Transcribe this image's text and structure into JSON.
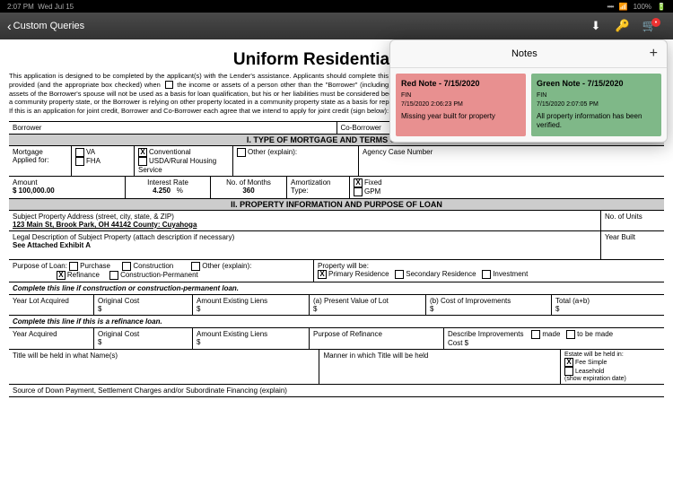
{
  "status": {
    "time": "2:07 PM",
    "date": "Wed Jul 15",
    "signal": "••••",
    "wifi": "◢",
    "battery": "100%"
  },
  "nav": {
    "back": "Custom Queries"
  },
  "notes": {
    "title": "Notes",
    "items": [
      {
        "title": "Red Note - 7/15/2020",
        "sub": "FIN",
        "ts": "7/15/2020 2:06:23 PM",
        "body": "Missing year built for property"
      },
      {
        "title": "Green Note - 7/15/2020",
        "sub": "FIN",
        "ts": "7/15/2020 2:07:05 PM",
        "body": "All property information has been verified."
      }
    ]
  },
  "doc": {
    "title": "Uniform Residential Loan",
    "intro": "This application is designed to be completed by the applicant(s) with the Lender's assistance. Applicants should complete this form as \"Borrower\" or \"Co-Borrower\", as applicable. Co-Borrower information must also be provided (and the appropriate box checked) when ☐ the income or assets of a person other than the \"Borrower\" (including the Borrower's spouse) will be used as a basis for loan qualification or ☐ the income or assets of the Borrower's spouse will not be used as a basis for loan qualification, but his or her liabilities must be considered because the Borrower resides in a community property state, the security property is located in a community property state, or the Borrower is relying on other property located in a community property state as a basis for repayment of the loan.",
    "intro2": "If this is an application for joint credit, Borrower and Co-Borrower each agree that we intend to apply for joint credit (sign below):",
    "borrower": "Borrower",
    "coborrower": "Co-Borrower",
    "sec1": "I. TYPE OF MORTGAGE AND TERMS OF LOAN",
    "mortgage": {
      "lbl": "Mortgage",
      "applied": "Applied for:",
      "va": "VA",
      "fha": "FHA",
      "conv": "Conventional",
      "usda": "USDA/Rural Housing Service",
      "other": "Other (explain):",
      "agency": "Agency Case Number"
    },
    "amount": {
      "lbl": "Amount",
      "val": "$ 100,000.00",
      "rate_lbl": "Interest Rate",
      "rate": "4.250",
      "pct": "%",
      "months_lbl": "No. of Months",
      "months": "360",
      "amort_lbl": "Amortization Type:",
      "fixed": "Fixed",
      "gpm": "GPM"
    },
    "sec2": "II. PROPERTY INFORMATION AND PURPOSE OF LOAN",
    "addr_lbl": "Subject Property Address (street, city, state, & ZIP)",
    "addr": "123 Main St, Brook Park, OH 44142 County: Cuyahoga",
    "units": "No. of Units",
    "legal_lbl": "Legal Description of Subject Property (attach description if necessary)",
    "legal": "See Attached Exhibit A",
    "year_built": "Year Built",
    "purpose": {
      "lbl": "Purpose of Loan:",
      "purchase": "Purchase",
      "refi": "Refinance",
      "constr": "Construction",
      "constrperm": "Construction-Permanent",
      "other": "Other (explain):"
    },
    "propwill": {
      "lbl": "Property will be:",
      "primary": "Primary Residence",
      "secondary": "Secondary Residence",
      "invest": "Investment"
    },
    "line1": "Complete this line if construction or construction-permanent loan.",
    "constr_cols": {
      "a": "Year Lot Acquired",
      "b": "Original Cost",
      "c": "Amount Existing Liens",
      "d": "(a) Present Value of Lot",
      "e": "(b) Cost of Improvements",
      "f": "Total (a+b)"
    },
    "dollar": "$",
    "line2": "Complete this line if this is a refinance loan.",
    "refi_cols": {
      "a": "Year Acquired",
      "b": "Original Cost",
      "c": "Amount Existing Liens",
      "d": "Purpose of Refinance",
      "e": "Describe Improvements",
      "e2": "Cost $",
      "made": "made",
      "tobe": "to be made"
    },
    "title_lbl": "Title will be held in what Name(s)",
    "manner": "Manner in which Title will be held",
    "estate": {
      "lbl": "Estate will be held in:",
      "fee": "Fee Simple",
      "lease": "Leasehold",
      "exp": "(show expiration date)"
    },
    "source": "Source of Down Payment, Settlement Charges and/or Subordinate Financing (explain)"
  }
}
